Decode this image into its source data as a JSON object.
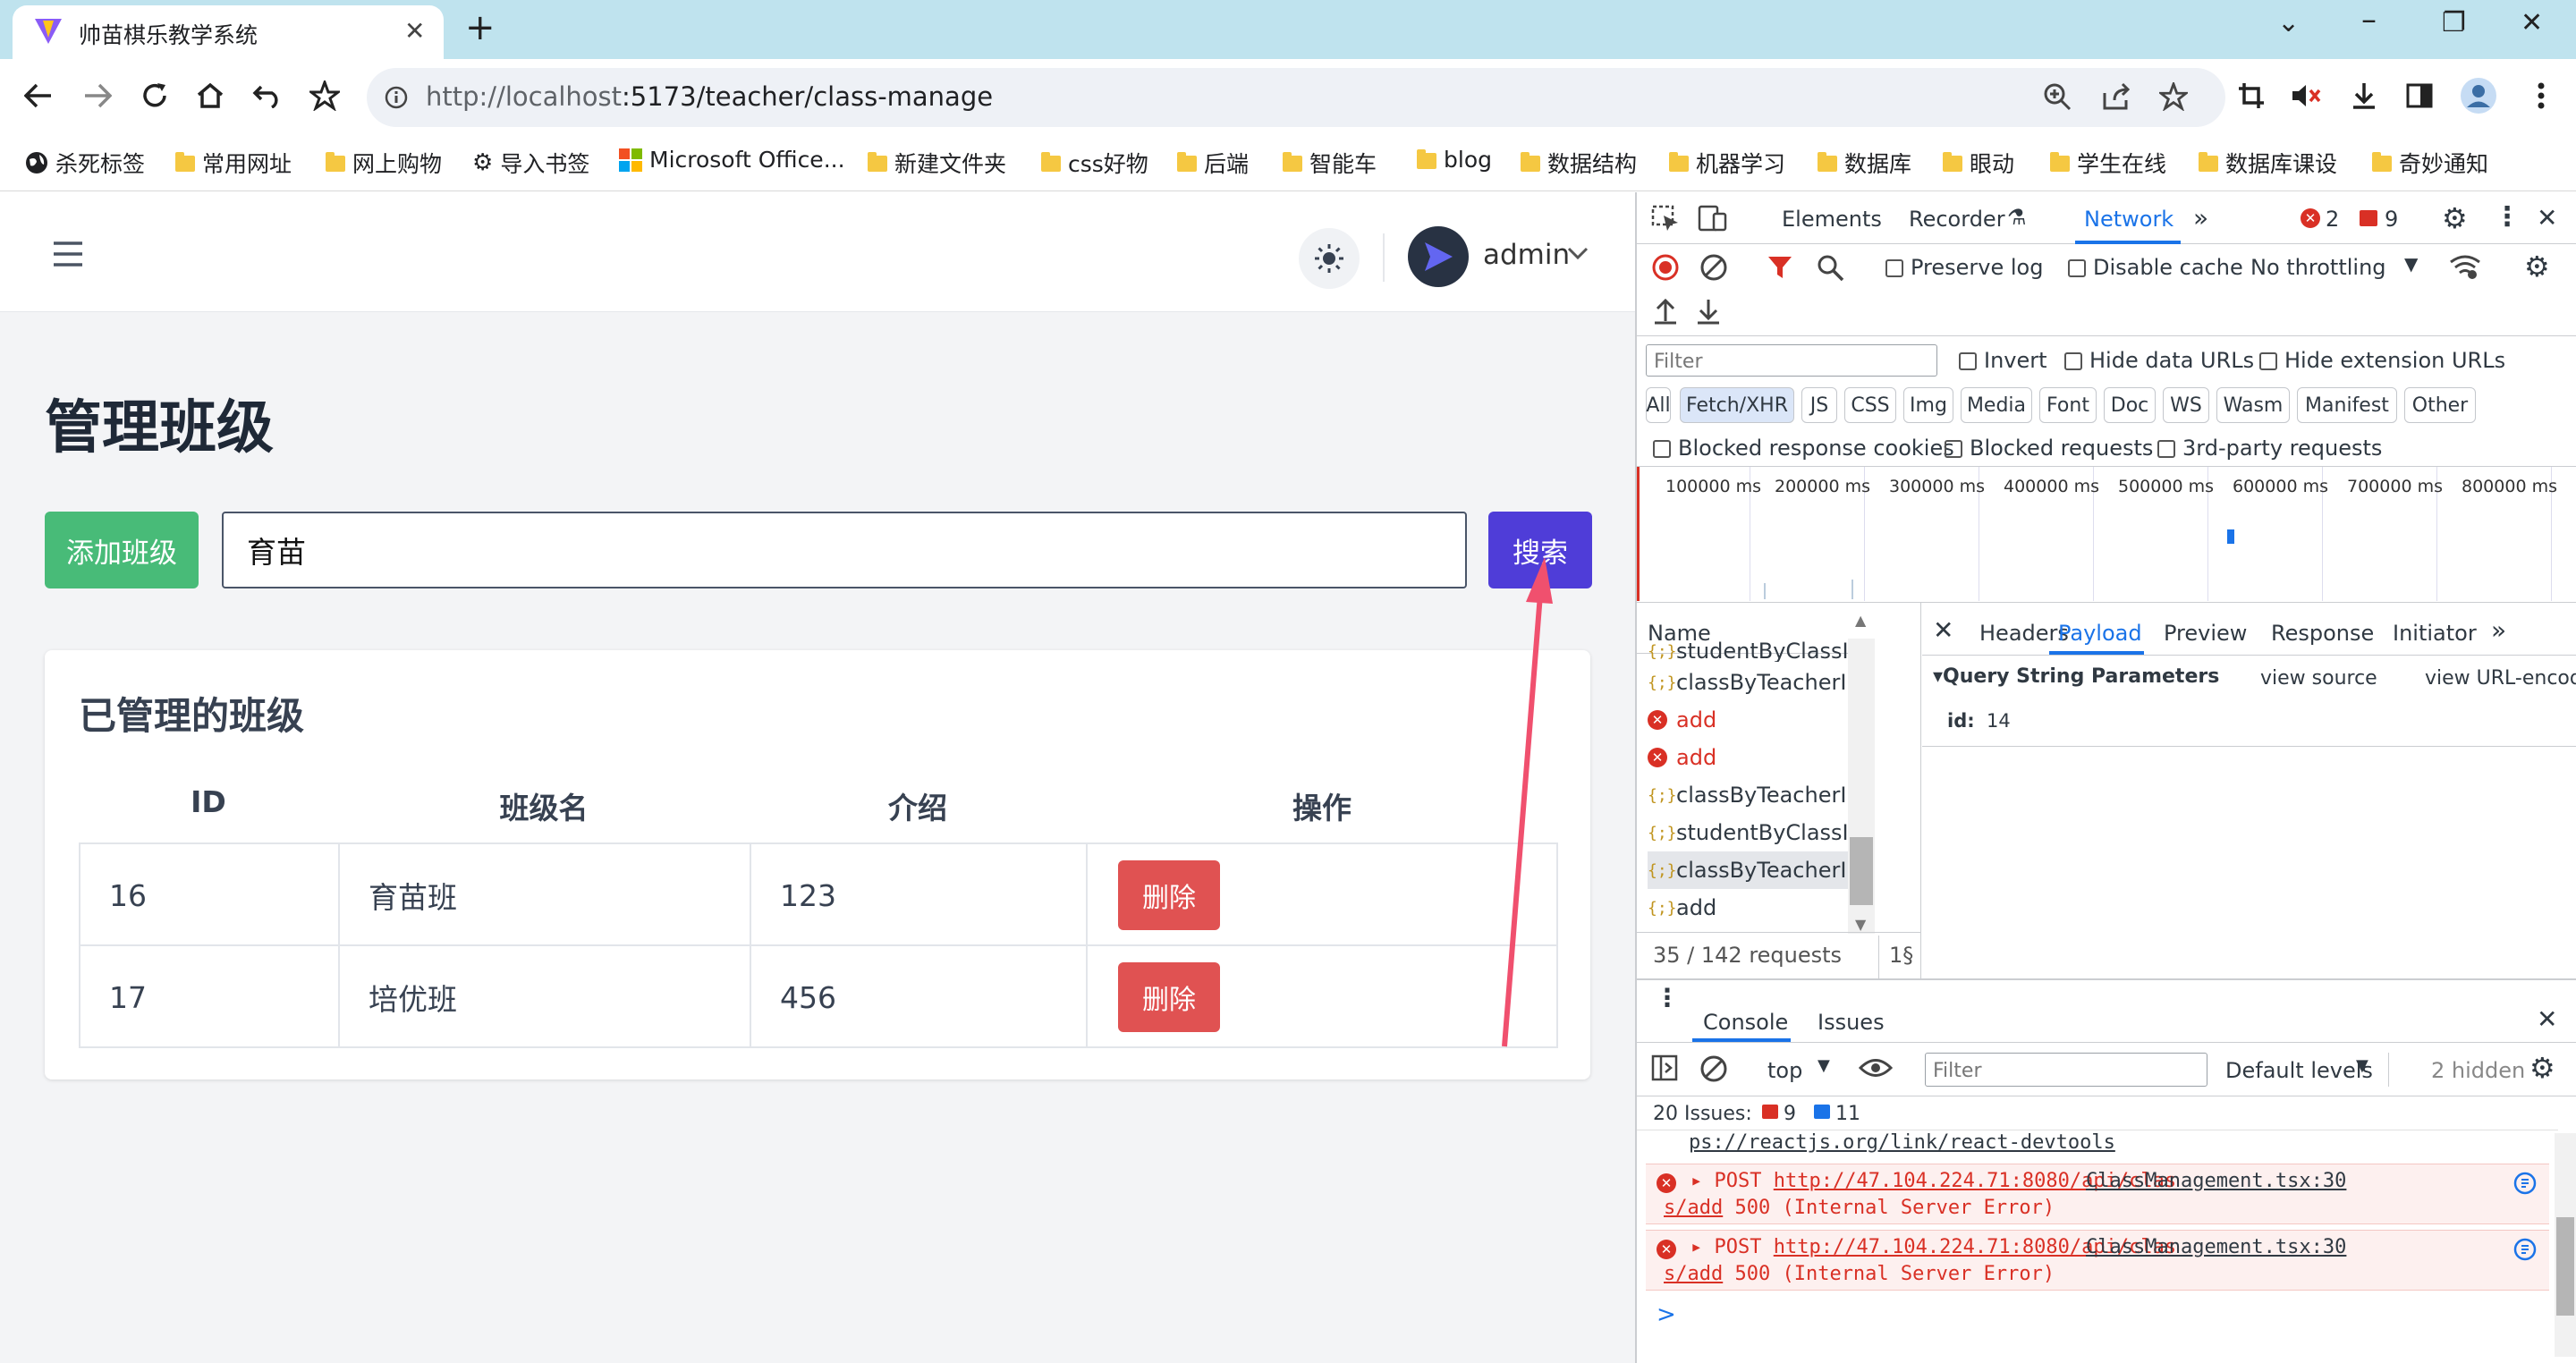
{
  "browser": {
    "tab_title": "帅苗棋乐教学系统",
    "url_host": "http://localhost",
    "url_path": ":5173/teacher/class-manage",
    "bookmarks": [
      "杀死标签",
      "常用网址",
      "网上购物",
      "导入书签",
      "Microsoft Office...",
      "新建文件夹",
      "css好物",
      "后端",
      "智能车",
      "blog",
      "数据结构",
      "机器学习",
      "数据库",
      "眼动",
      "学生在线",
      "数据库课设",
      "奇妙通知"
    ]
  },
  "app": {
    "user": "admin",
    "page_title": "管理班级",
    "add_button": "添加班级",
    "search_value": "育苗",
    "search_button": "搜索",
    "card_title": "已管理的班级",
    "columns": [
      "ID",
      "班级名",
      "介绍",
      "操作"
    ],
    "rows": [
      {
        "id": "16",
        "name": "育苗班",
        "intro": "123",
        "action": "删除"
      },
      {
        "id": "17",
        "name": "培优班",
        "intro": "456",
        "action": "删除"
      }
    ]
  },
  "devtools": {
    "tabs": [
      "Elements",
      "Recorder",
      "Network"
    ],
    "error_count": "2",
    "issue_count": "9",
    "preserve_log": "Preserve log",
    "disable_cache": "Disable cache",
    "throttling": "No throttling",
    "filter_placeholder": "Filter",
    "invert": "Invert",
    "hide_data_urls": "Hide data URLs",
    "hide_extension_urls": "Hide extension URLs",
    "type_filters": [
      "All",
      "Fetch/XHR",
      "JS",
      "CSS",
      "Img",
      "Media",
      "Font",
      "Doc",
      "WS",
      "Wasm",
      "Manifest",
      "Other"
    ],
    "blocked_cookies": "Blocked response cookies",
    "blocked_requests": "Blocked requests",
    "third_party": "3rd-party requests",
    "timeline_labels": [
      "100000 ms",
      "200000 ms",
      "300000 ms",
      "400000 ms",
      "500000 ms",
      "600000 ms",
      "700000 ms",
      "800000 ms"
    ],
    "name_header": "Name",
    "requests": [
      {
        "name": "studentByClassI...",
        "type": "fetch"
      },
      {
        "name": "classByTeacherI...",
        "type": "fetch"
      },
      {
        "name": "add",
        "type": "error"
      },
      {
        "name": "add",
        "type": "error"
      },
      {
        "name": "classByTeacherI...",
        "type": "fetch"
      },
      {
        "name": "studentByClassI...",
        "type": "fetch"
      },
      {
        "name": "classByTeacherI...",
        "type": "fetch"
      },
      {
        "name": "add",
        "type": "fetch"
      }
    ],
    "request_summary": "35 / 142 requests",
    "request_summary_cut": "1§",
    "detail_tabs": [
      "Headers",
      "Payload",
      "Preview",
      "Response",
      "Initiator"
    ],
    "query_title": "Query String Parameters",
    "view_source": "view source",
    "view_url_encoded": "view URL-encoded",
    "param_key": "id:",
    "param_value": "14",
    "drawer_tabs": [
      "Console",
      "Issues"
    ],
    "console_context": "top",
    "console_filter": "Filter",
    "default_levels": "Default levels",
    "hidden": "2 hidden",
    "issues_label": "20 Issues:",
    "issues_errors": "9",
    "issues_info": "11",
    "console_prev": "ps://reactjs.org/link/react-devtools",
    "errors": [
      {
        "method": "POST",
        "url1": "http://47.104.224.71:8080/api/clas",
        "url2": "s/add",
        "status": "500 (Internal Server Error)",
        "source": "ClassManagement.tsx:30"
      },
      {
        "method": "POST",
        "url1": "http://47.104.224.71:8080/api/clas",
        "url2": "s/add",
        "status": "500 (Internal Server Error)",
        "source": "ClassManagement.tsx:30"
      }
    ],
    "prompt": ">"
  },
  "colors": {
    "add": "#48bb78",
    "search": "#4f3dd8",
    "delete": "#e05252",
    "arrow": "#f0506e",
    "devtools_accent": "#1a73e8"
  }
}
